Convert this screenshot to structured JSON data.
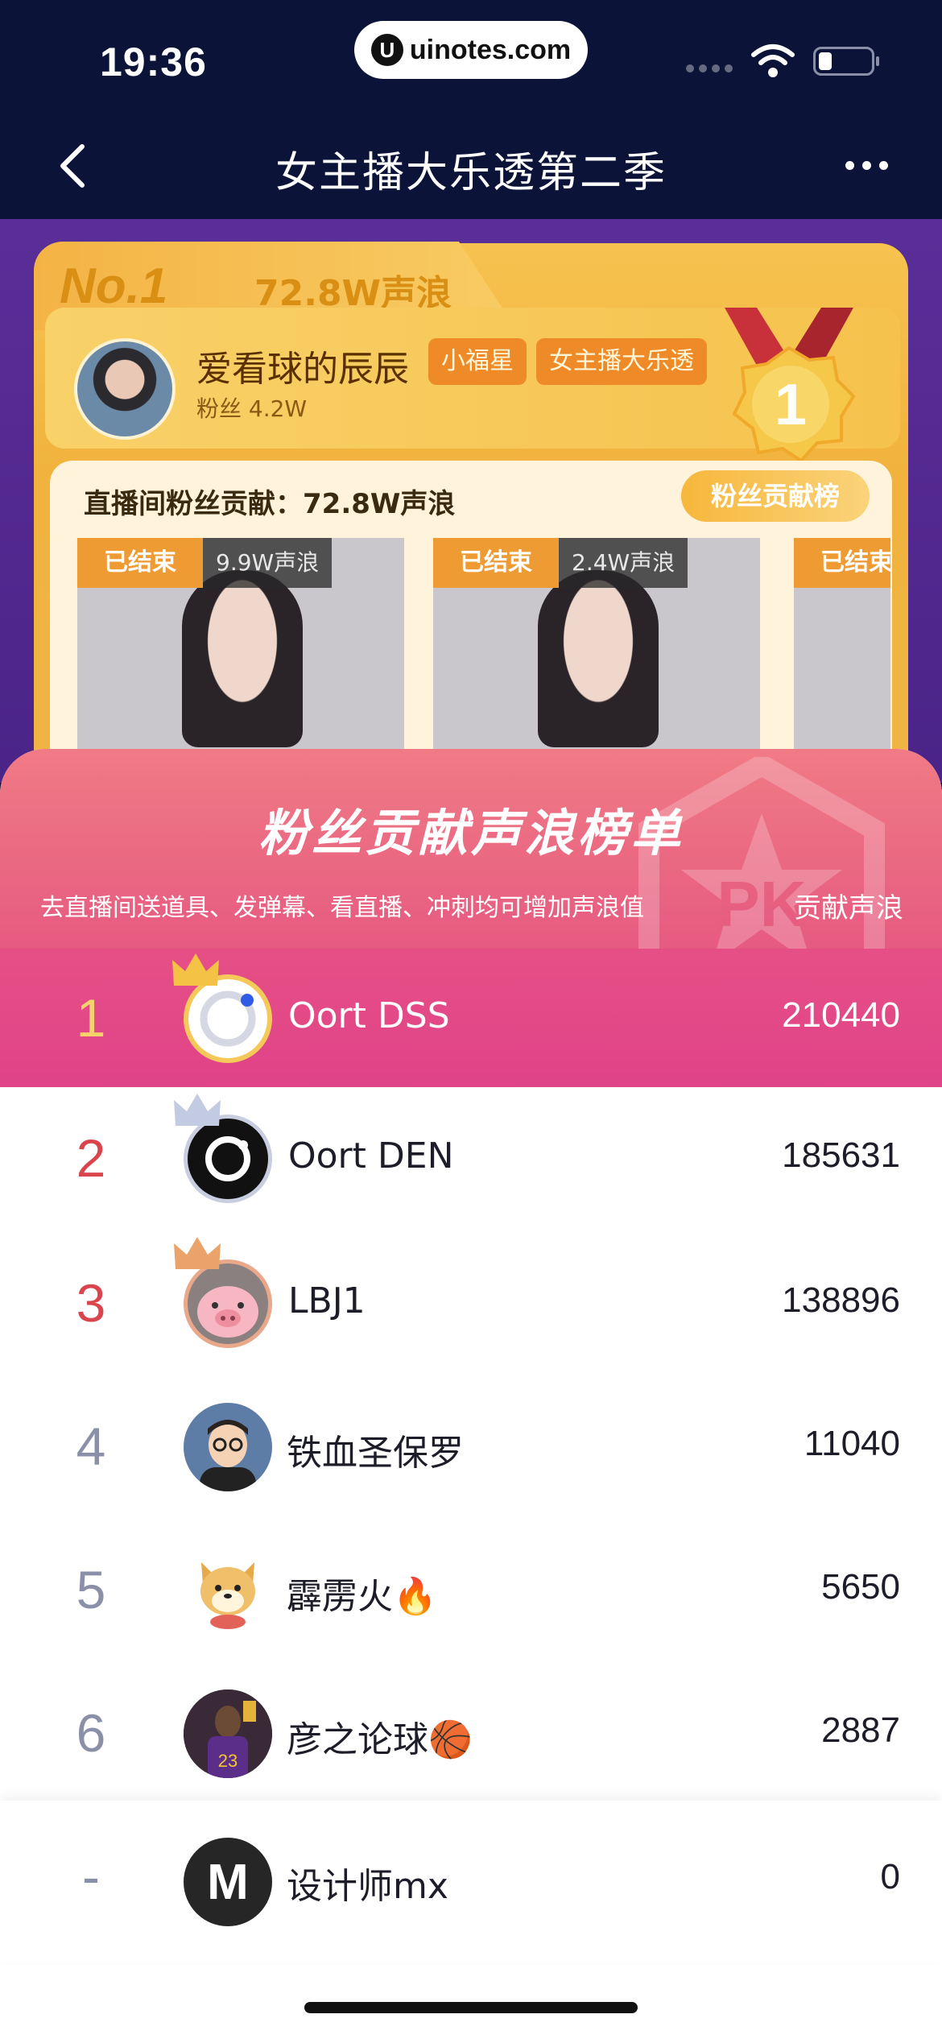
{
  "status_bar": {
    "time": "19:36",
    "url": "uinotes.com",
    "url_logo": "U"
  },
  "header": {
    "title": "女主播大乐透第二季"
  },
  "banner": {
    "rank_tab": "No.1",
    "tab_score": "72.8W声浪",
    "streamer_name": "爱看球的辰辰",
    "streamer_fans": "粉丝 4.2W",
    "tags": [
      "小福星",
      "女主播大乐透"
    ],
    "medal_number": "1",
    "contribution_title": "直播间粉丝贡献：72.8W声浪",
    "contribution_button": "粉丝贡献榜",
    "streams": [
      {
        "status": "已结束",
        "score": "9.9W声浪"
      },
      {
        "status": "已结束",
        "score": "2.4W声浪"
      },
      {
        "status": "已结束",
        "score": ""
      }
    ]
  },
  "rank_panel": {
    "title": "粉丝贡献声浪榜单",
    "hint": "去直播间送道具、发弹幕、看直播、冲刺均可增加声浪值",
    "column_label": "贡献声浪",
    "deco_text": "PK",
    "rows": [
      {
        "rank": "1",
        "name": "Oort DSS",
        "value": "210440",
        "avatar": "oort-dss-avatar",
        "crown": "gold"
      },
      {
        "rank": "2",
        "name": "Oort DEN",
        "value": "185631",
        "avatar": "oort-den-avatar",
        "crown": "silver"
      },
      {
        "rank": "3",
        "name": "LBJ1",
        "value": "138896",
        "avatar": "pig-avatar",
        "crown": "bronze"
      },
      {
        "rank": "4",
        "name": "铁血圣保罗",
        "value": "11040",
        "avatar": "cartoon-man-avatar"
      },
      {
        "rank": "5",
        "name": "霹雳火🔥",
        "value": "5650",
        "avatar": "shiba-dog-avatar"
      },
      {
        "rank": "6",
        "name": "彦之论球🏀",
        "value": "2887",
        "avatar": "basketball-player-avatar"
      }
    ],
    "self": {
      "rank": "-",
      "name": "设计师mx",
      "value": "0",
      "avatar": "mx-logo-avatar",
      "avatar_text": "M"
    }
  },
  "colors": {
    "top_bar": "#0b1438",
    "rank_header": "#e65a80",
    "rank_gold": "#f5d36b",
    "rank_red": "#d9444d",
    "rank_gray": "#8a90a8"
  }
}
